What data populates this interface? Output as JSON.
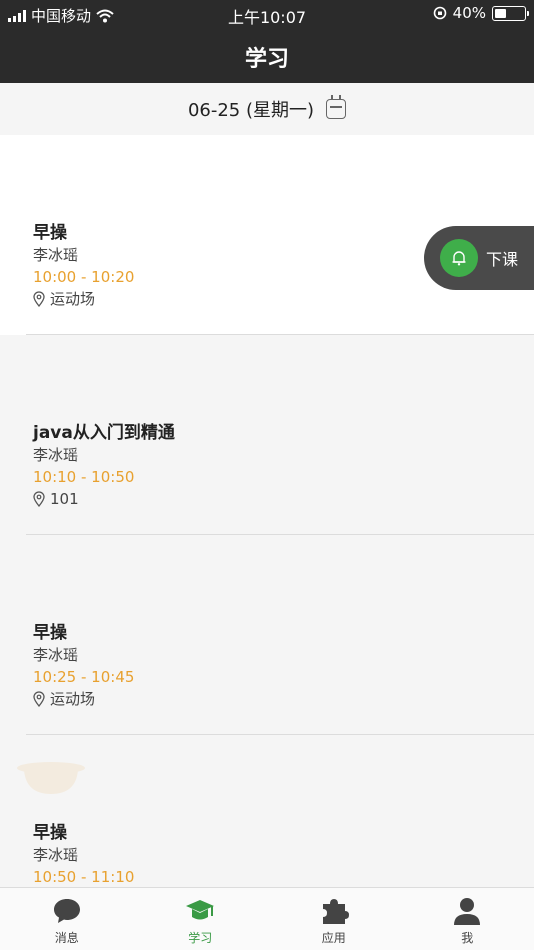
{
  "status_bar": {
    "carrier": "中国移动",
    "time": "上午10:07",
    "battery_text": "40%",
    "battery_level": 0.4
  },
  "nav": {
    "title": "学习"
  },
  "date_bar": {
    "date": "06-25 (星期一)"
  },
  "courses": [
    {
      "name": "早操",
      "teacher": "李冰瑶",
      "time": "10:00 - 10:20",
      "location": "运动场"
    },
    {
      "name": "java从入门到精通",
      "teacher": "李冰瑶",
      "time": "10:10 - 10:50",
      "location": "101"
    },
    {
      "name": "早操",
      "teacher": "李冰瑶",
      "time": "10:25 - 10:45",
      "location": "运动场"
    },
    {
      "name": "早操",
      "teacher": "李冰瑶",
      "time": "10:50 - 11:10",
      "location": ""
    }
  ],
  "float_button": {
    "label": "下课"
  },
  "tabs": [
    {
      "label": "消息",
      "icon": "chat-bubble-icon"
    },
    {
      "label": "学习",
      "icon": "graduation-cap-icon"
    },
    {
      "label": "应用",
      "icon": "puzzle-icon"
    },
    {
      "label": "我",
      "icon": "person-icon"
    }
  ],
  "colors": {
    "accent": "#3a9a45",
    "time": "#e8a12f",
    "header": "#2b2b2b"
  }
}
